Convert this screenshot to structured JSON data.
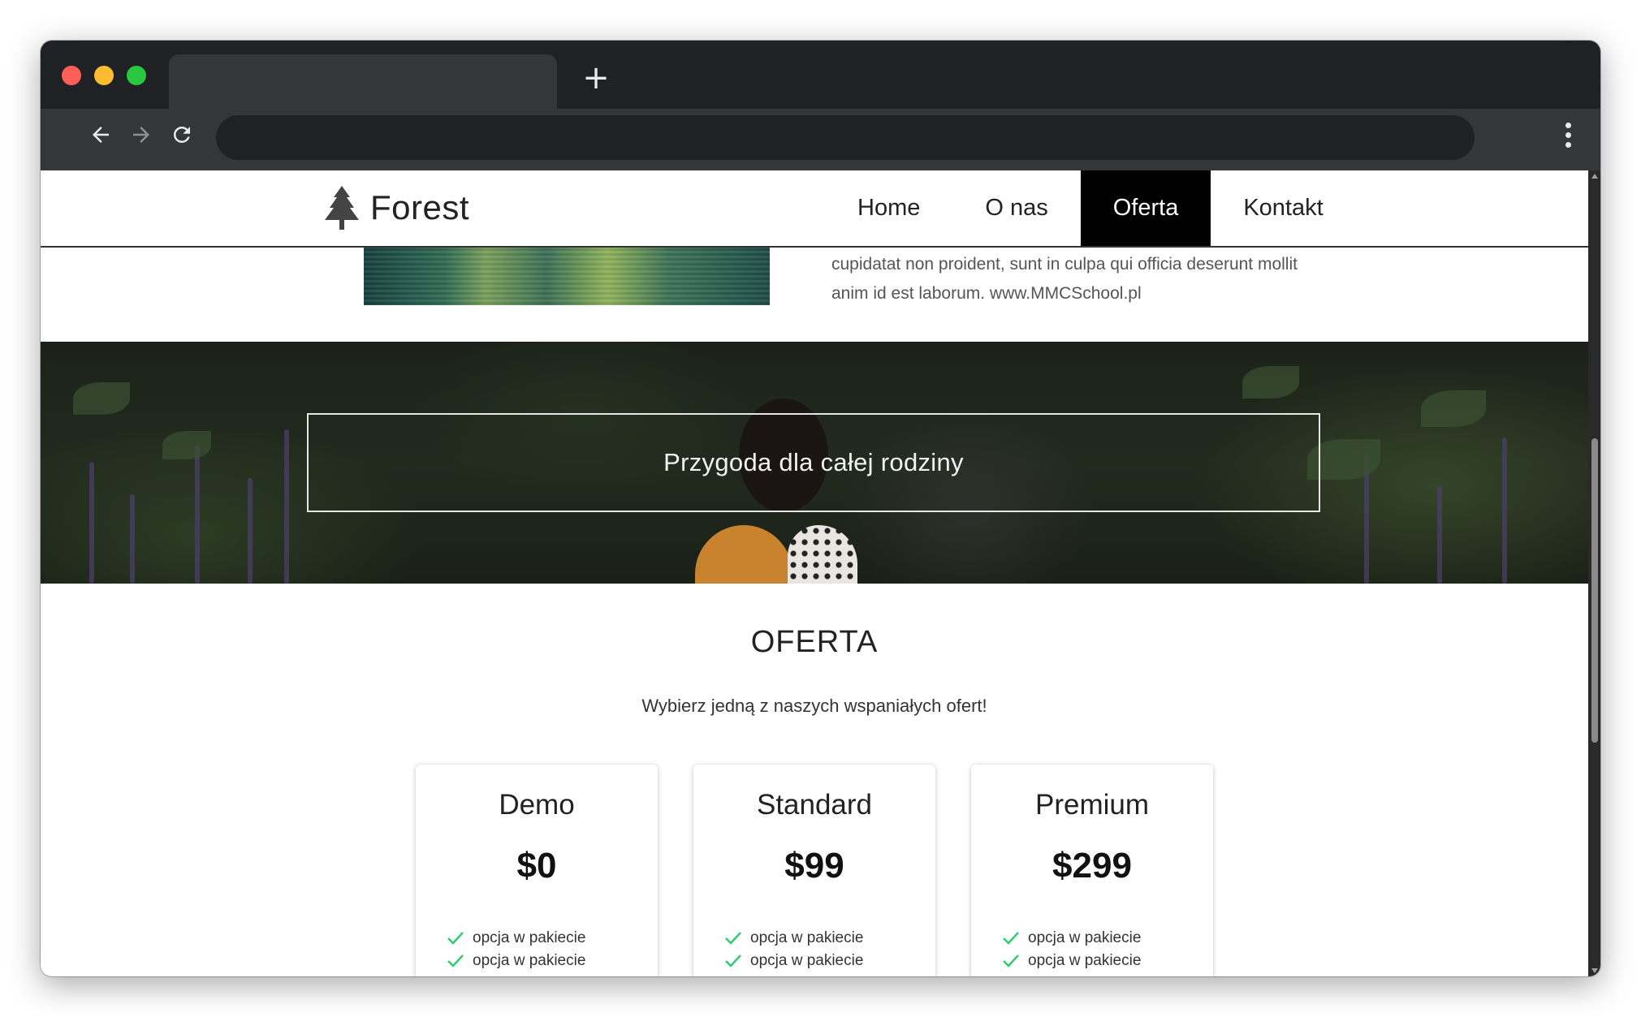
{
  "browser": {
    "new_tab_label": "+",
    "back_icon": "arrow-left-icon",
    "forward_icon": "arrow-right-icon",
    "reload_icon": "reload-icon",
    "menu_icon": "more-vert-icon"
  },
  "site": {
    "logo_text": "Forest",
    "logo_icon": "tree-icon",
    "nav": [
      {
        "label": "Home",
        "active": false
      },
      {
        "label": "O nas",
        "active": false
      },
      {
        "label": "Oferta",
        "active": true
      },
      {
        "label": "Kontakt",
        "active": false
      }
    ]
  },
  "about": {
    "text_line1": "cupidatat non proident, sunt in culpa qui officia deserunt mollit",
    "text_line2": "anim id est laborum. www.MMCSchool.pl"
  },
  "hero": {
    "title": "Przygoda dla całej rodziny"
  },
  "offer": {
    "heading": "OFERTA",
    "subtitle": "Wybierz jedną z naszych wspaniałych ofert!",
    "cards": [
      {
        "name": "Demo",
        "price": "$0",
        "features": [
          "opcja w pakiecie",
          "opcja w pakiecie"
        ]
      },
      {
        "name": "Standard",
        "price": "$99",
        "features": [
          "opcja w pakiecie",
          "opcja w pakiecie"
        ]
      },
      {
        "name": "Premium",
        "price": "$299",
        "features": [
          "opcja w pakiecie",
          "opcja w pakiecie"
        ]
      }
    ],
    "check_color": "#2ecc71"
  }
}
